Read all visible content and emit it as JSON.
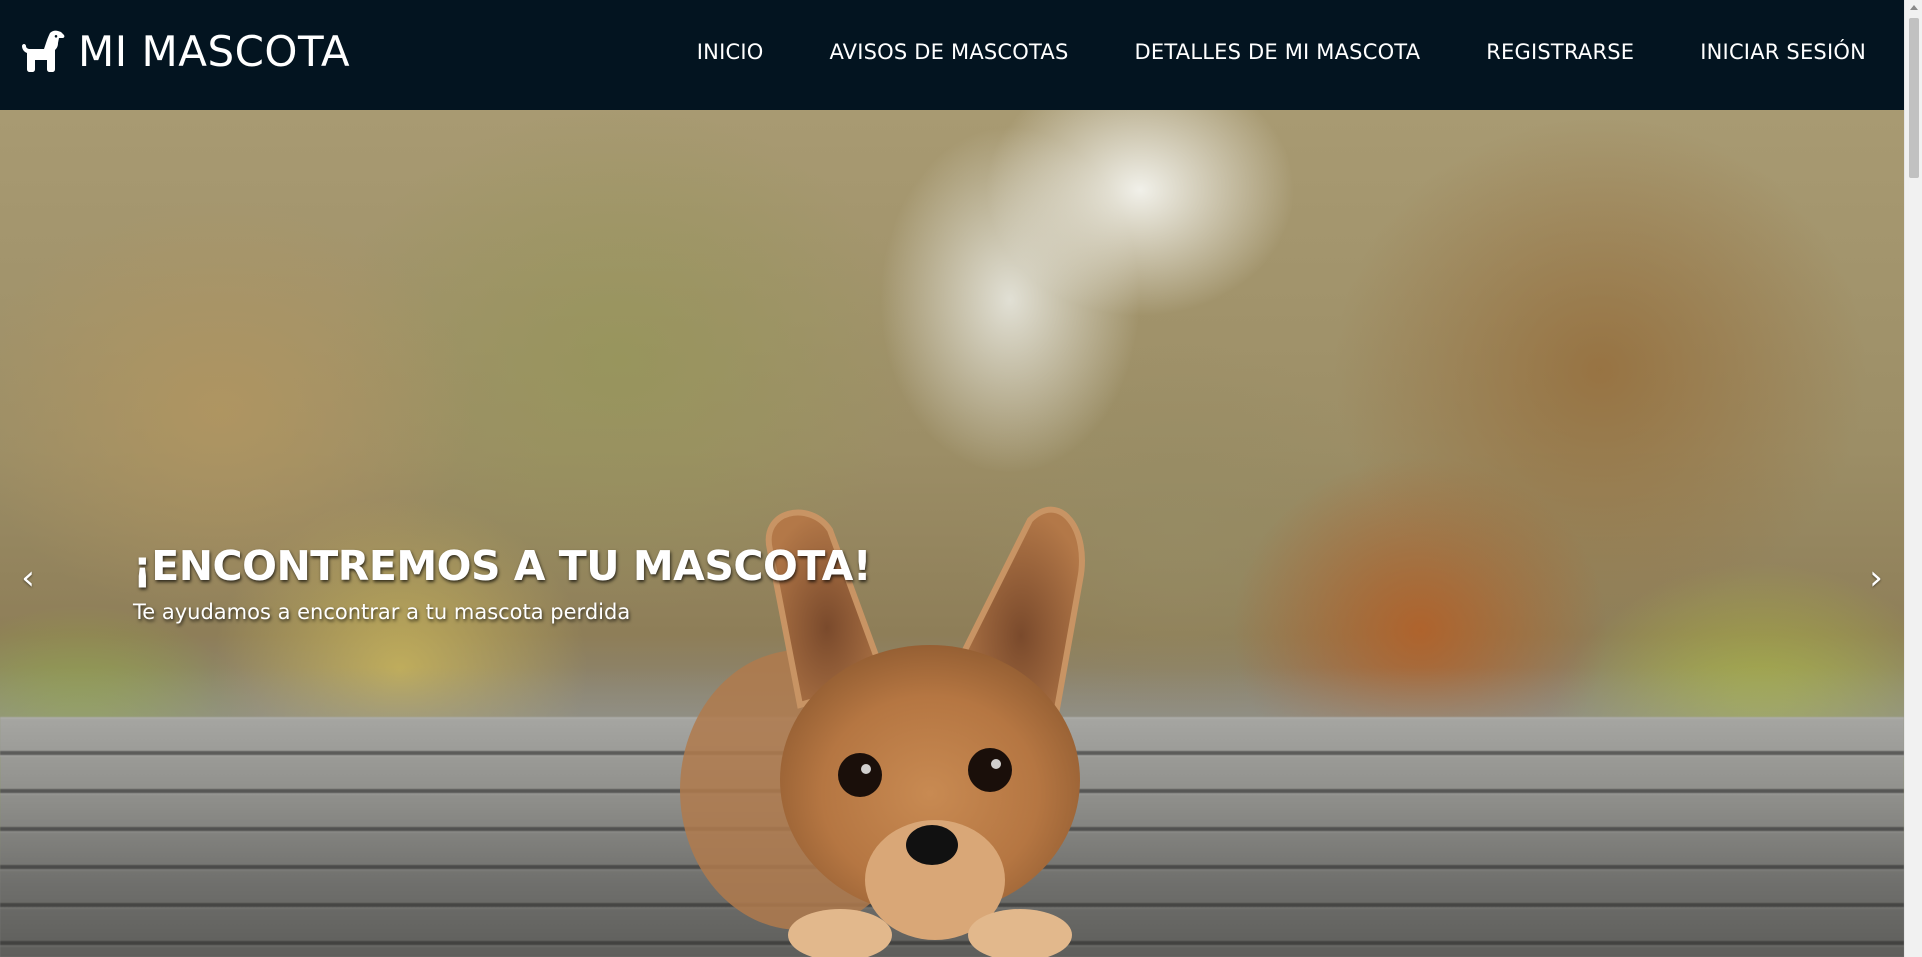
{
  "brand": {
    "name": "MI MASCOTA",
    "icon": "dog-icon"
  },
  "nav": {
    "items": [
      {
        "label": "INICIO"
      },
      {
        "label": "AVISOS DE MASCOTAS"
      },
      {
        "label": "DETALLES DE MI MASCOTA"
      },
      {
        "label": "REGISTRARSE"
      },
      {
        "label": "INICIAR SESIÓN"
      }
    ]
  },
  "hero": {
    "title": "¡ENCONTREMOS A TU MASCOTA!",
    "subtitle": "Te ayudamos a encontrar a tu mascota perdida",
    "prev_label": "‹",
    "next_label": "›",
    "image": "chihuahua-dog-on-boardwalk-photo"
  },
  "colors": {
    "navbar_bg": "#031420",
    "nav_text": "#ffffff",
    "caption_text": "#ffffff"
  }
}
